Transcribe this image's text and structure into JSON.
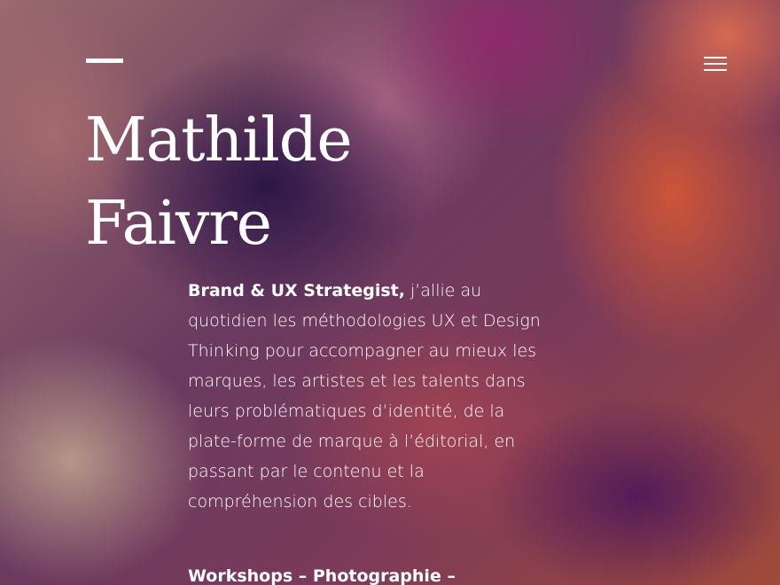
{
  "header": {
    "menu_icon": "hamburger-menu-icon",
    "dash_icon": "dash-icon"
  },
  "hero": {
    "name_line1": "Mathilde",
    "name_line2": "Faivre",
    "intro_strong": "Brand & UX Strategist,",
    "intro_text": " j’allie au quotidien les méthodologies UX et Design Thinking pour accompagner au mieux les marques, les artistes et les talents dans leurs problématiques d’identité, de la plate-forme de marque à l’éditorial, en passant par le contenu et la compréhension des cibles.",
    "services": "Workshops – Photographie –"
  },
  "colors": {
    "text": "#ffffff",
    "background_dark": "#3a1f52",
    "background_warm": "#c8553a"
  }
}
